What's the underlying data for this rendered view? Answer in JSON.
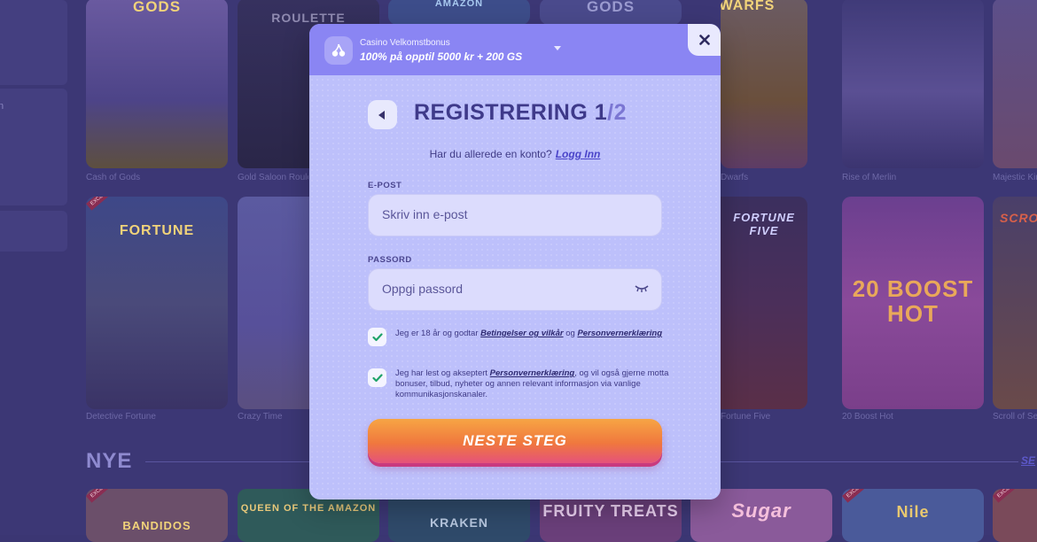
{
  "background": {
    "sidebar_letter": "n",
    "row1_tiles": [
      {
        "title": "GODS",
        "caption": "Cash of Gods"
      },
      {
        "title": "ROULETTE",
        "caption": "Gold Saloon Roulette"
      },
      {
        "title": "AMAZON",
        "caption": ""
      },
      {
        "title": "GODS",
        "caption": ""
      },
      {
        "title": "DWARFS",
        "caption": "Dwarfs"
      },
      {
        "title": "",
        "caption": "Rise of Merlin"
      },
      {
        "title": "",
        "caption": "Majestic King"
      }
    ],
    "row2_tiles": [
      {
        "title": "FORTUNE",
        "caption": "Detective Fortune"
      },
      {
        "title": "",
        "caption": "Crazy Time"
      },
      {
        "title": "",
        "caption": ""
      },
      {
        "title": "",
        "caption": ""
      },
      {
        "title": "FORTUNE FIVE",
        "caption": "Fortune Five"
      },
      {
        "title": "20 BOOST HOT",
        "caption": "20 Boost Hot"
      },
      {
        "title": "SCRO",
        "caption": "Scroll of Seth"
      }
    ],
    "row3_tiles": [
      {
        "title": "BANDIDOS"
      },
      {
        "title": "QUEEN OF THE AMAZON"
      },
      {
        "title": "KRAKEN"
      },
      {
        "title": "FRUITY TREATS"
      },
      {
        "title": "Sugar"
      },
      {
        "title": "Nile"
      },
      {
        "title": ""
      }
    ],
    "exclusive_badge": "EXCLUSIVE",
    "section_title": "NYE",
    "see_all": "SE"
  },
  "modal": {
    "bonus": {
      "title": "Casino Velkomstbonus",
      "text": "100% på opptil 5000 kr + 200 GS"
    },
    "close_label": "×",
    "heading_main": "REGISTRERING 1",
    "heading_sep": "/2",
    "login_prompt": "Har du allerede en konto?",
    "login_link": "Logg Inn",
    "email": {
      "label": "E-POST",
      "placeholder": "Skriv inn e-post"
    },
    "password": {
      "label": "PASSORD",
      "placeholder": "Oppgi passord"
    },
    "consent1": {
      "checked": true,
      "pre": "Jeg er 18 år og godtar ",
      "link1": "Betingelser og vilkår",
      "mid": " og ",
      "link2": "Personvernerklæring"
    },
    "consent2": {
      "checked": true,
      "pre": "Jeg har lest og akseptert ",
      "link": "Personvernerklæring",
      "post": ", og vil også gjerne motta bonuser, tilbud, nyheter og annen relevant informasjon via vanlige kommunikasjonskanaler."
    },
    "next_button": "NESTE STEG"
  },
  "colors": {
    "page_bg": "#3c3775",
    "modal_bg": "#bdc0fb",
    "banner": "#8a85f3",
    "title": "#3f3a8a",
    "link": "#4a44c9",
    "button_top": "#f7a544",
    "button_bottom": "#e5527b",
    "check": "#1fa36a"
  }
}
